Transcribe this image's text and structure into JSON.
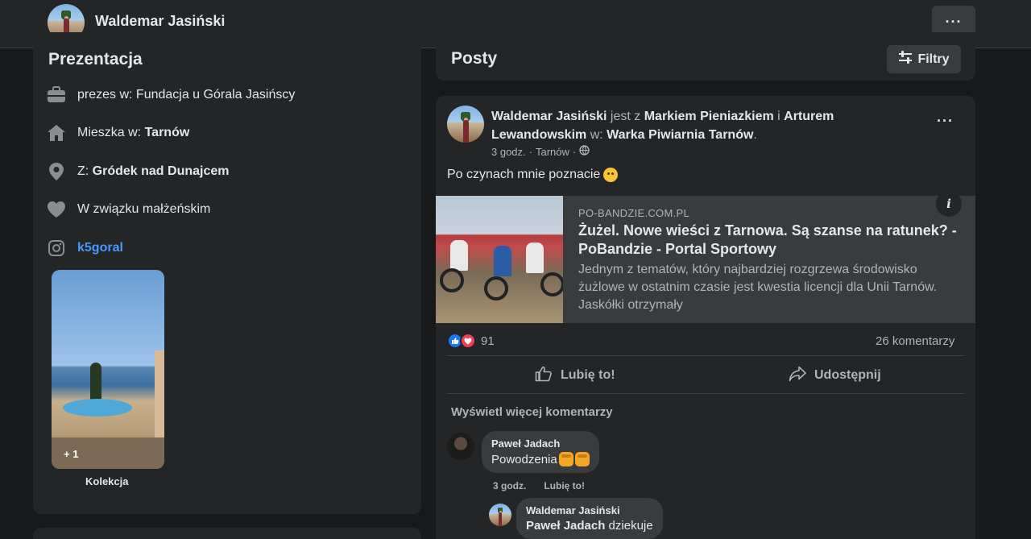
{
  "profile": {
    "name": "Waldemar Jasiński",
    "more_label": "···"
  },
  "intro": {
    "title": "Prezentacja",
    "rows": [
      {
        "icon": "briefcase-icon",
        "prefix": "prezes w: Fundacja u Górala Jasińscy",
        "value": ""
      },
      {
        "icon": "home-icon",
        "prefix": "Mieszka w: ",
        "value": "Tarnów"
      },
      {
        "icon": "location-pin-icon",
        "prefix": "Z: ",
        "value": "Gródek nad Dunajcem"
      },
      {
        "icon": "heart-icon",
        "prefix": "W związku małżeńskim",
        "value": ""
      },
      {
        "icon": "instagram-icon",
        "prefix": "",
        "value": "k5goral"
      }
    ],
    "collection": {
      "count": "+ 1",
      "label": "Kolekcja"
    }
  },
  "posts_header": {
    "title": "Posty",
    "filter_label": "Filtry"
  },
  "post": {
    "author": "Waldemar Jasiński",
    "with_word": " jest z ",
    "tag1": "Markiem Pieniazkiem",
    "and_word": " i ",
    "tag2": "Arturem Lewandowskim",
    "at_word": " w: ",
    "place": "Warka Piwiarnia Tarnów",
    "end": ".",
    "time": "3 godz.",
    "sep": "·",
    "location": "Tarnów",
    "sep2": "·",
    "text": "Po czynach mnie poznacie",
    "link": {
      "domain": "PO-BANDZIE.COM.PL",
      "title": "Żużel. Nowe wieści z Tarnowa. Są szanse na ratunek? - PoBandzie - Portal Sportowy",
      "description": "Jednym z tematów, który najbardziej rozgrzewa środowisko żużlowe w ostatnim czasie jest kwestia licencji dla Unii Tarnów. Jaskółki otrzymały",
      "info": "i"
    },
    "reaction_count": "91",
    "comments_count": "26 komentarzy",
    "like_label": "Lubię to!",
    "share_label": "Udostępnij",
    "more_comments": "Wyświetl więcej komentarzy"
  },
  "comments": [
    {
      "author": "Paweł Jadach",
      "text": "Powodzenia",
      "time": "3 godz.",
      "like": "Lubię to!"
    },
    {
      "author": "Waldemar Jasiński",
      "mention": "Paweł Jadach",
      "text": " dziekuje"
    }
  ],
  "colors": {
    "background": "#18191a",
    "card": "#242526",
    "link": "#4599ff",
    "like_blue": "#1877f2",
    "love_red": "#f33e58"
  }
}
